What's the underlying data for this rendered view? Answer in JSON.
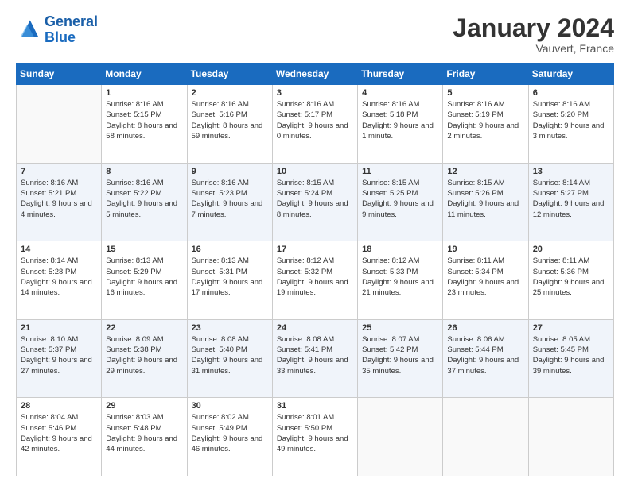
{
  "header": {
    "logo_line1": "General",
    "logo_line2": "Blue",
    "month": "January 2024",
    "location": "Vauvert, France"
  },
  "weekdays": [
    "Sunday",
    "Monday",
    "Tuesday",
    "Wednesday",
    "Thursday",
    "Friday",
    "Saturday"
  ],
  "weeks": [
    [
      {
        "day": "",
        "sunrise": "",
        "sunset": "",
        "daylight": ""
      },
      {
        "day": "1",
        "sunrise": "Sunrise: 8:16 AM",
        "sunset": "Sunset: 5:15 PM",
        "daylight": "Daylight: 8 hours and 58 minutes."
      },
      {
        "day": "2",
        "sunrise": "Sunrise: 8:16 AM",
        "sunset": "Sunset: 5:16 PM",
        "daylight": "Daylight: 8 hours and 59 minutes."
      },
      {
        "day": "3",
        "sunrise": "Sunrise: 8:16 AM",
        "sunset": "Sunset: 5:17 PM",
        "daylight": "Daylight: 9 hours and 0 minutes."
      },
      {
        "day": "4",
        "sunrise": "Sunrise: 8:16 AM",
        "sunset": "Sunset: 5:18 PM",
        "daylight": "Daylight: 9 hours and 1 minute."
      },
      {
        "day": "5",
        "sunrise": "Sunrise: 8:16 AM",
        "sunset": "Sunset: 5:19 PM",
        "daylight": "Daylight: 9 hours and 2 minutes."
      },
      {
        "day": "6",
        "sunrise": "Sunrise: 8:16 AM",
        "sunset": "Sunset: 5:20 PM",
        "daylight": "Daylight: 9 hours and 3 minutes."
      }
    ],
    [
      {
        "day": "7",
        "sunrise": "Sunrise: 8:16 AM",
        "sunset": "Sunset: 5:21 PM",
        "daylight": "Daylight: 9 hours and 4 minutes."
      },
      {
        "day": "8",
        "sunrise": "Sunrise: 8:16 AM",
        "sunset": "Sunset: 5:22 PM",
        "daylight": "Daylight: 9 hours and 5 minutes."
      },
      {
        "day": "9",
        "sunrise": "Sunrise: 8:16 AM",
        "sunset": "Sunset: 5:23 PM",
        "daylight": "Daylight: 9 hours and 7 minutes."
      },
      {
        "day": "10",
        "sunrise": "Sunrise: 8:15 AM",
        "sunset": "Sunset: 5:24 PM",
        "daylight": "Daylight: 9 hours and 8 minutes."
      },
      {
        "day": "11",
        "sunrise": "Sunrise: 8:15 AM",
        "sunset": "Sunset: 5:25 PM",
        "daylight": "Daylight: 9 hours and 9 minutes."
      },
      {
        "day": "12",
        "sunrise": "Sunrise: 8:15 AM",
        "sunset": "Sunset: 5:26 PM",
        "daylight": "Daylight: 9 hours and 11 minutes."
      },
      {
        "day": "13",
        "sunrise": "Sunrise: 8:14 AM",
        "sunset": "Sunset: 5:27 PM",
        "daylight": "Daylight: 9 hours and 12 minutes."
      }
    ],
    [
      {
        "day": "14",
        "sunrise": "Sunrise: 8:14 AM",
        "sunset": "Sunset: 5:28 PM",
        "daylight": "Daylight: 9 hours and 14 minutes."
      },
      {
        "day": "15",
        "sunrise": "Sunrise: 8:13 AM",
        "sunset": "Sunset: 5:29 PM",
        "daylight": "Daylight: 9 hours and 16 minutes."
      },
      {
        "day": "16",
        "sunrise": "Sunrise: 8:13 AM",
        "sunset": "Sunset: 5:31 PM",
        "daylight": "Daylight: 9 hours and 17 minutes."
      },
      {
        "day": "17",
        "sunrise": "Sunrise: 8:12 AM",
        "sunset": "Sunset: 5:32 PM",
        "daylight": "Daylight: 9 hours and 19 minutes."
      },
      {
        "day": "18",
        "sunrise": "Sunrise: 8:12 AM",
        "sunset": "Sunset: 5:33 PM",
        "daylight": "Daylight: 9 hours and 21 minutes."
      },
      {
        "day": "19",
        "sunrise": "Sunrise: 8:11 AM",
        "sunset": "Sunset: 5:34 PM",
        "daylight": "Daylight: 9 hours and 23 minutes."
      },
      {
        "day": "20",
        "sunrise": "Sunrise: 8:11 AM",
        "sunset": "Sunset: 5:36 PM",
        "daylight": "Daylight: 9 hours and 25 minutes."
      }
    ],
    [
      {
        "day": "21",
        "sunrise": "Sunrise: 8:10 AM",
        "sunset": "Sunset: 5:37 PM",
        "daylight": "Daylight: 9 hours and 27 minutes."
      },
      {
        "day": "22",
        "sunrise": "Sunrise: 8:09 AM",
        "sunset": "Sunset: 5:38 PM",
        "daylight": "Daylight: 9 hours and 29 minutes."
      },
      {
        "day": "23",
        "sunrise": "Sunrise: 8:08 AM",
        "sunset": "Sunset: 5:40 PM",
        "daylight": "Daylight: 9 hours and 31 minutes."
      },
      {
        "day": "24",
        "sunrise": "Sunrise: 8:08 AM",
        "sunset": "Sunset: 5:41 PM",
        "daylight": "Daylight: 9 hours and 33 minutes."
      },
      {
        "day": "25",
        "sunrise": "Sunrise: 8:07 AM",
        "sunset": "Sunset: 5:42 PM",
        "daylight": "Daylight: 9 hours and 35 minutes."
      },
      {
        "day": "26",
        "sunrise": "Sunrise: 8:06 AM",
        "sunset": "Sunset: 5:44 PM",
        "daylight": "Daylight: 9 hours and 37 minutes."
      },
      {
        "day": "27",
        "sunrise": "Sunrise: 8:05 AM",
        "sunset": "Sunset: 5:45 PM",
        "daylight": "Daylight: 9 hours and 39 minutes."
      }
    ],
    [
      {
        "day": "28",
        "sunrise": "Sunrise: 8:04 AM",
        "sunset": "Sunset: 5:46 PM",
        "daylight": "Daylight: 9 hours and 42 minutes."
      },
      {
        "day": "29",
        "sunrise": "Sunrise: 8:03 AM",
        "sunset": "Sunset: 5:48 PM",
        "daylight": "Daylight: 9 hours and 44 minutes."
      },
      {
        "day": "30",
        "sunrise": "Sunrise: 8:02 AM",
        "sunset": "Sunset: 5:49 PM",
        "daylight": "Daylight: 9 hours and 46 minutes."
      },
      {
        "day": "31",
        "sunrise": "Sunrise: 8:01 AM",
        "sunset": "Sunset: 5:50 PM",
        "daylight": "Daylight: 9 hours and 49 minutes."
      },
      {
        "day": "",
        "sunrise": "",
        "sunset": "",
        "daylight": ""
      },
      {
        "day": "",
        "sunrise": "",
        "sunset": "",
        "daylight": ""
      },
      {
        "day": "",
        "sunrise": "",
        "sunset": "",
        "daylight": ""
      }
    ]
  ]
}
